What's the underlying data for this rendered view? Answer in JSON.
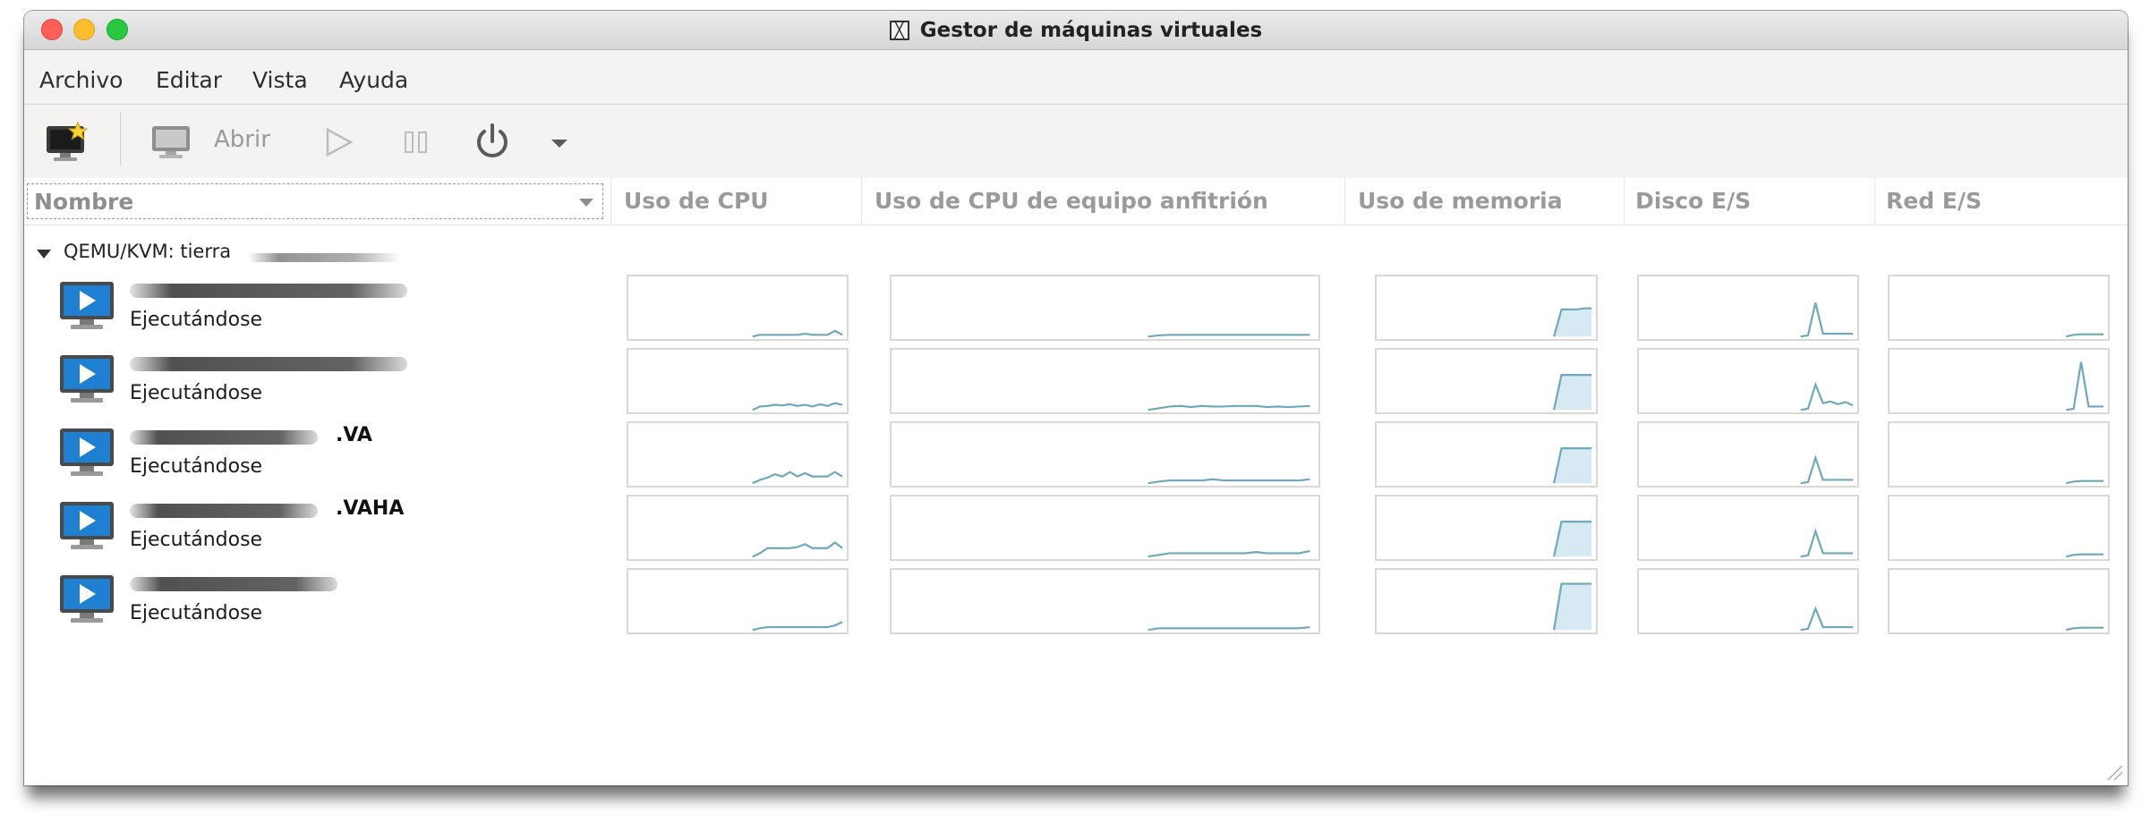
{
  "window": {
    "title": "Gestor de máquinas virtuales"
  },
  "menubar": {
    "items": [
      "Archivo",
      "Editar",
      "Vista",
      "Ayuda"
    ]
  },
  "toolbar": {
    "new_vm_icon": "monitor-new-icon",
    "open_label": "Abrir",
    "open_icon": "monitor-icon",
    "run_icon": "play-icon",
    "pause_icon": "pause-icon",
    "shutdown_icon": "power-icon",
    "more_icon": "chevron-down-icon"
  },
  "columns": {
    "name": "Nombre",
    "cpu": "Uso de CPU",
    "host_cpu": "Uso de CPU de equipo anfitrión",
    "memory": "Uso de memoria",
    "disk": "Disco E/S",
    "net": "Red E/S"
  },
  "group": {
    "label": "QEMU/KVM: tierra"
  },
  "colors": {
    "graph_line": "#6fa8b8",
    "graph_fill": "#d7eaf3",
    "graph_border": "#d8d8d8",
    "vm_icon_blue": "#1f7fd0"
  },
  "vms": [
    {
      "name_suffix": "",
      "status": "Ejecutándose",
      "cpu": [
        0,
        0,
        0,
        0.03,
        0.03,
        0.03,
        0.03,
        0.03,
        0.03,
        0.05,
        0.03,
        0.03,
        0.03,
        0.1,
        0.03
      ],
      "host_cpu": [
        0,
        0,
        0,
        0,
        0,
        0.02,
        0.03,
        0.03,
        0.03,
        0.03,
        0.03,
        0.03,
        0.03,
        0.03,
        0.03,
        0.03,
        0.03,
        0.03,
        0.03,
        0.03
      ],
      "memory": [
        0,
        0,
        0,
        0,
        0,
        0,
        0,
        0,
        0,
        0,
        0.48,
        0.48,
        0.48,
        0.5,
        0.5
      ],
      "disk": [
        0,
        0,
        0,
        0,
        0,
        0,
        0,
        0,
        0.02,
        0.6,
        0.05,
        0.05,
        0.05,
        0.05,
        0.05
      ],
      "net": [
        0,
        0,
        0,
        0,
        0,
        0,
        0,
        0,
        0,
        0,
        0.03,
        0.04,
        0.04,
        0.04,
        0.04
      ]
    },
    {
      "name_suffix": "",
      "status": "Ejecutándose",
      "cpu": [
        0,
        0,
        0,
        0.06,
        0.07,
        0.09,
        0.08,
        0.1,
        0.07,
        0.09,
        0.06,
        0.1,
        0.07,
        0.12,
        0.09
      ],
      "host_cpu": [
        0,
        0,
        0,
        0,
        0,
        0.03,
        0.06,
        0.07,
        0.05,
        0.07,
        0.06,
        0.06,
        0.07,
        0.07,
        0.07,
        0.05,
        0.06,
        0.05,
        0.06,
        0.07
      ],
      "memory": [
        0,
        0,
        0,
        0,
        0,
        0,
        0,
        0,
        0,
        0,
        0.62,
        0.62,
        0.62,
        0.62,
        0.62
      ],
      "disk": [
        0,
        0,
        0,
        0,
        0,
        0,
        0,
        0,
        0.02,
        0.45,
        0.12,
        0.15,
        0.1,
        0.14,
        0.08
      ],
      "net": [
        0,
        0,
        0,
        0,
        0,
        0,
        0,
        0,
        0,
        0,
        0.02,
        0.85,
        0.06,
        0.06,
        0.06
      ]
    },
    {
      "name_suffix": ".VA",
      "status": "Ejecutándose",
      "cpu": [
        0,
        0,
        0,
        0.06,
        0.1,
        0.16,
        0.12,
        0.2,
        0.12,
        0.18,
        0.12,
        0.12,
        0.12,
        0.2,
        0.12
      ],
      "host_cpu": [
        0,
        0,
        0,
        0,
        0,
        0.03,
        0.05,
        0.05,
        0.05,
        0.05,
        0.07,
        0.05,
        0.05,
        0.05,
        0.05,
        0.05,
        0.05,
        0.05,
        0.05,
        0.07
      ],
      "memory": [
        0,
        0,
        0,
        0,
        0,
        0,
        0,
        0,
        0,
        0,
        0.62,
        0.62,
        0.62,
        0.62,
        0.62
      ],
      "disk": [
        0,
        0,
        0,
        0,
        0,
        0,
        0,
        0,
        0.02,
        0.45,
        0.06,
        0.06,
        0.06,
        0.06,
        0.06
      ],
      "net": [
        0,
        0,
        0,
        0,
        0,
        0,
        0,
        0,
        0,
        0,
        0.03,
        0.04,
        0.04,
        0.04,
        0.04
      ]
    },
    {
      "name_suffix": ".VAHA",
      "status": "Ejecutándose",
      "cpu": [
        0,
        0,
        0,
        0.06,
        0.15,
        0.15,
        0.15,
        0.15,
        0.17,
        0.22,
        0.15,
        0.15,
        0.15,
        0.25,
        0.15
      ],
      "host_cpu": [
        0,
        0,
        0,
        0,
        0,
        0.03,
        0.06,
        0.06,
        0.06,
        0.06,
        0.06,
        0.06,
        0.06,
        0.06,
        0.08,
        0.06,
        0.06,
        0.06,
        0.06,
        0.1
      ],
      "memory": [
        0,
        0,
        0,
        0,
        0,
        0,
        0,
        0,
        0,
        0,
        0.62,
        0.62,
        0.62,
        0.62,
        0.62
      ],
      "disk": [
        0,
        0,
        0,
        0,
        0,
        0,
        0,
        0,
        0.02,
        0.45,
        0.06,
        0.06,
        0.06,
        0.06,
        0.06
      ],
      "net": [
        0,
        0,
        0,
        0,
        0,
        0,
        0,
        0,
        0,
        0,
        0.03,
        0.04,
        0.04,
        0.04,
        0.04
      ]
    },
    {
      "name_suffix": "",
      "status": "Ejecutándose",
      "cpu": [
        0,
        0,
        0,
        0.03,
        0.05,
        0.05,
        0.05,
        0.05,
        0.05,
        0.05,
        0.05,
        0.05,
        0.05,
        0.08,
        0.14
      ],
      "host_cpu": [
        0,
        0,
        0,
        0,
        0,
        0.03,
        0.03,
        0.03,
        0.03,
        0.03,
        0.03,
        0.03,
        0.03,
        0.03,
        0.03,
        0.03,
        0.03,
        0.03,
        0.03,
        0.05
      ],
      "memory": [
        0,
        0,
        0,
        0,
        0,
        0,
        0,
        0,
        0,
        0,
        0.82,
        0.82,
        0.82,
        0.82,
        0.82
      ],
      "disk": [
        0,
        0,
        0,
        0,
        0,
        0,
        0,
        0,
        0.02,
        0.38,
        0.05,
        0.05,
        0.05,
        0.05,
        0.05
      ],
      "net": [
        0,
        0,
        0,
        0,
        0,
        0,
        0,
        0,
        0,
        0,
        0.03,
        0.04,
        0.04,
        0.04,
        0.04
      ]
    }
  ]
}
